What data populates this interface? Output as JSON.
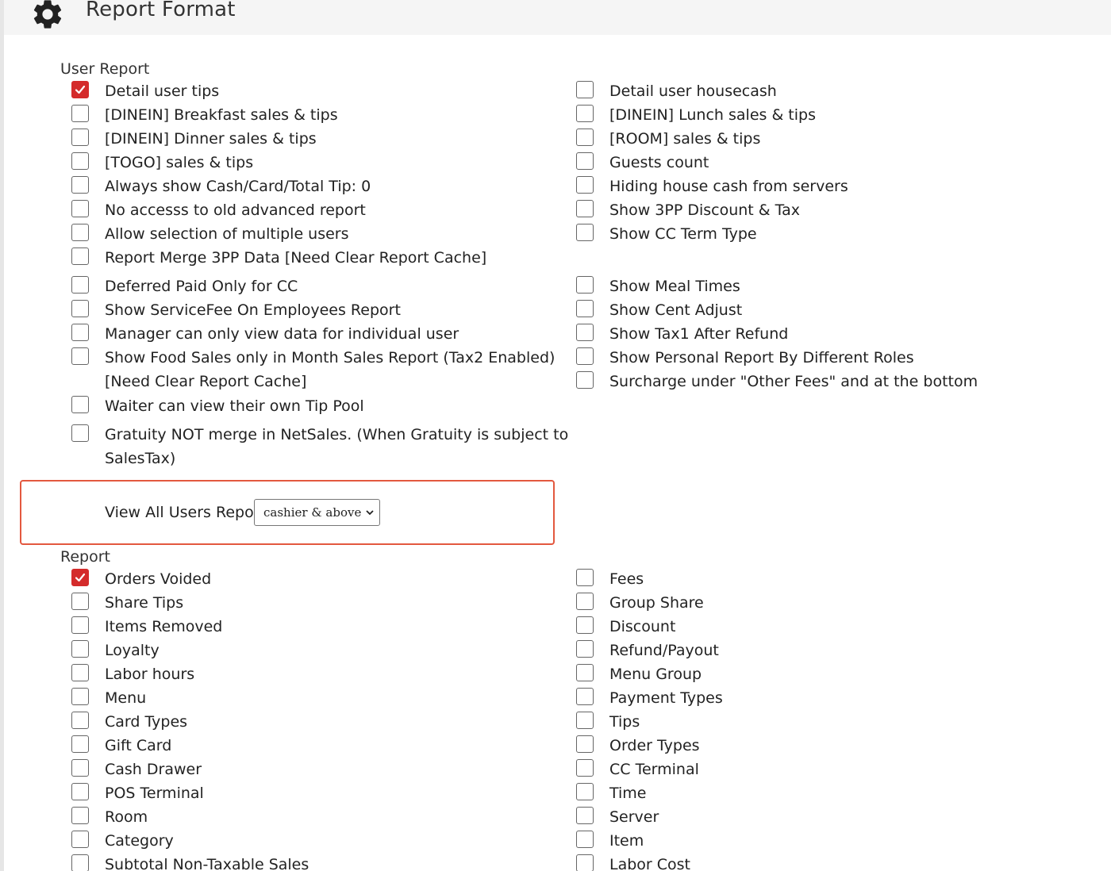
{
  "header": {
    "title": "Report Format",
    "icon": "gear-icon"
  },
  "user_report": {
    "title": "User Report",
    "left": [
      {
        "label": "Detail user tips",
        "checked": true
      },
      {
        "label": "[DINEIN] Breakfast sales & tips",
        "checked": false
      },
      {
        "label": "[DINEIN] Dinner sales & tips",
        "checked": false
      },
      {
        "label": "[TOGO] sales & tips",
        "checked": false
      },
      {
        "label": "Always show Cash/Card/Total Tip: 0",
        "checked": false
      },
      {
        "label": "No accesss to old advanced report",
        "checked": false
      },
      {
        "label": "Allow selection of multiple users",
        "checked": false
      },
      {
        "label": "Report Merge 3PP Data [Need Clear Report Cache]",
        "checked": false
      },
      {
        "label": "Deferred Paid Only for CC",
        "checked": false
      },
      {
        "label": "Show ServiceFee On Employees Report",
        "checked": false
      },
      {
        "label": "Manager can only view data for individual user",
        "checked": false
      },
      {
        "label": "Show Food Sales only in Month Sales Report (Tax2 Enabled)",
        "label2": "[Need Clear Report Cache]",
        "checked": false
      },
      {
        "label": "Waiter can view their own Tip Pool",
        "checked": false
      },
      {
        "label": "Gratuity NOT merge in NetSales. (When Gratuity is subject to",
        "label2": "SalesTax)",
        "checked": false
      }
    ],
    "right": [
      {
        "label": "Detail user housecash",
        "checked": false
      },
      {
        "label": "[DINEIN] Lunch sales & tips",
        "checked": false
      },
      {
        "label": "[ROOM] sales & tips",
        "checked": false
      },
      {
        "label": "Guests count",
        "checked": false
      },
      {
        "label": "Hiding house cash from servers",
        "checked": false
      },
      {
        "label": "Show 3PP Discount & Tax",
        "checked": false
      },
      {
        "label": "Show CC Term Type",
        "checked": false
      },
      {
        "label": "Show Meal Times",
        "checked": false
      },
      {
        "label": "Show Cent Adjust",
        "checked": false
      },
      {
        "label": "Show Tax1 After Refund",
        "checked": false
      },
      {
        "label": "Show Personal Report By Different Roles",
        "checked": false
      },
      {
        "label": "Surcharge under \"Other Fees\" and at the bottom",
        "checked": false
      }
    ]
  },
  "view_all": {
    "label": "View All Users Report",
    "selected": "cashier & above"
  },
  "report": {
    "title": "Report",
    "left": [
      {
        "label": "Orders Voided",
        "checked": true
      },
      {
        "label": "Share Tips",
        "checked": false
      },
      {
        "label": "Items Removed",
        "checked": false
      },
      {
        "label": "Loyalty",
        "checked": false
      },
      {
        "label": "Labor hours",
        "checked": false
      },
      {
        "label": "Menu",
        "checked": false
      },
      {
        "label": "Card Types",
        "checked": false
      },
      {
        "label": "Gift Card",
        "checked": false
      },
      {
        "label": "Cash Drawer",
        "checked": false
      },
      {
        "label": "POS Terminal",
        "checked": false
      },
      {
        "label": "Room",
        "checked": false
      },
      {
        "label": "Category",
        "checked": false
      },
      {
        "label": "Subtotal Non-Taxable Sales",
        "checked": false
      }
    ],
    "right": [
      {
        "label": "Fees",
        "checked": false
      },
      {
        "label": "Group Share",
        "checked": false
      },
      {
        "label": "Discount",
        "checked": false
      },
      {
        "label": "Refund/Payout",
        "checked": false
      },
      {
        "label": "Menu Group",
        "checked": false
      },
      {
        "label": "Payment Types",
        "checked": false
      },
      {
        "label": "Tips",
        "checked": false
      },
      {
        "label": "Order Types",
        "checked": false
      },
      {
        "label": "CC Terminal",
        "checked": false
      },
      {
        "label": "Time",
        "checked": false
      },
      {
        "label": "Server",
        "checked": false
      },
      {
        "label": "Item",
        "checked": false
      },
      {
        "label": "Labor Cost",
        "checked": false
      }
    ]
  },
  "colors": {
    "accent": "#d42b2b",
    "highlight_border": "#e3583f",
    "header_bg": "#f5f5f5"
  }
}
